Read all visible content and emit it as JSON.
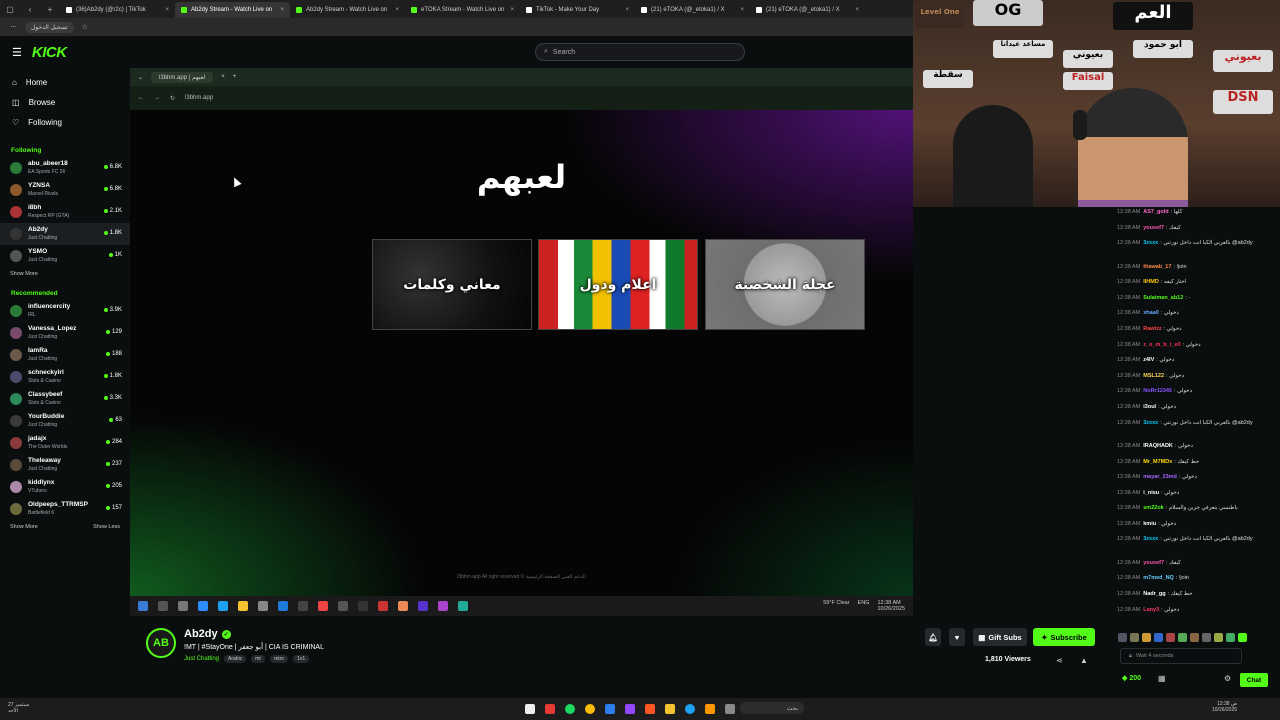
{
  "browser": {
    "tabs": [
      {
        "label": "(36)Ab2dy (@r2c) | TikTok",
        "color": "#ffffff",
        "active": false
      },
      {
        "label": "Ab2dy Stream - Watch Live on",
        "color": "#53fc18",
        "active": true
      },
      {
        "label": "Ab2dy Stream - Watch Live on",
        "color": "#53fc18",
        "active": false
      },
      {
        "label": "eTOKA Stream - Watch Live on",
        "color": "#53fc18",
        "active": false
      },
      {
        "label": "TikTok - Make Your Day",
        "color": "#ffffff",
        "active": false
      },
      {
        "label": "(21) eTOKA (@_etoka1) / X",
        "color": "#ffffff",
        "active": false
      },
      {
        "label": "(21) eTOKA (@_etoka1) / X",
        "color": "#ffffff",
        "active": false
      }
    ],
    "signin_label": "تسجيل الدخول"
  },
  "header": {
    "logo": "KICK",
    "search_placeholder": "Search"
  },
  "sidebar": {
    "nav": [
      {
        "icon": "home-icon",
        "label": "Home"
      },
      {
        "icon": "browse-icon",
        "label": "Browse"
      },
      {
        "icon": "heart-icon",
        "label": "Following"
      }
    ],
    "following_title": "Following",
    "following": [
      {
        "name": "abu_abeer18",
        "category": "EA Sports FC 26",
        "viewers": "6.8K",
        "color": "#2b7a3a"
      },
      {
        "name": "YZNSA",
        "category": "Marvel Rivals",
        "viewers": "6.8K",
        "color": "#8a5a2a"
      },
      {
        "name": "i8bh",
        "category": "Respect RP (GTA)",
        "viewers": "2.1K",
        "color": "#aa3333"
      },
      {
        "name": "Ab2dy",
        "category": "Just Chatting",
        "viewers": "1.8K",
        "color": "#333333"
      },
      {
        "name": "YSMO",
        "category": "Just Chatting",
        "viewers": "1K",
        "color": "#555555"
      }
    ],
    "show_more": "Show More",
    "recommended_title": "Recommended",
    "recommended": [
      {
        "name": "influencercity",
        "category": "IRL",
        "viewers": "3.9K",
        "color": "#2a7a3a"
      },
      {
        "name": "Vanessa_Lopez",
        "category": "Just Chatting",
        "viewers": "129",
        "color": "#7a4a6a"
      },
      {
        "name": "IamRa",
        "category": "Just Chatting",
        "viewers": "188",
        "color": "#6a5a4a"
      },
      {
        "name": "schneckyirl",
        "category": "Slots & Casino",
        "viewers": "1.8K",
        "color": "#4a4a6a"
      },
      {
        "name": "Classybeef",
        "category": "Slots & Casino",
        "viewers": "3.3K",
        "color": "#2a8a5a"
      },
      {
        "name": "YourBuddie",
        "category": "Just Chatting",
        "viewers": "63",
        "color": "#3a3a3a"
      },
      {
        "name": "jadajx",
        "category": "The Outer Worlds",
        "viewers": "284",
        "color": "#8a3a3a"
      },
      {
        "name": "Theleaway",
        "category": "Just Chatting",
        "viewers": "237",
        "color": "#5a4a3a"
      },
      {
        "name": "kiddlynx",
        "category": "VTubers",
        "viewers": "205",
        "color": "#aa88aa"
      },
      {
        "name": "Oldpeeps_TTRMSP",
        "category": "Battlefield 6",
        "viewers": "157",
        "color": "#6a6a3a"
      }
    ],
    "show_more2": "Show More",
    "show_less": "Show Less"
  },
  "stream": {
    "inner_tab": "l3bhm.app | لعبهم",
    "inner_url": "l3bhm.app",
    "game_title": "لعبهم",
    "cards": [
      {
        "label": "معاني وكلمات"
      },
      {
        "label": "اعلام ودول"
      },
      {
        "label": "عجلة الشخصنة"
      }
    ],
    "footer": "l3bhm.app All right reserved ©   الدعم الفني   الصفحة الرئيسية",
    "weather": "59°F  Clear",
    "lang": "ENG",
    "clock": "12:38 AM\n10/26/2025"
  },
  "streamer": {
    "name": "Ab2dy",
    "avatar_text": "AB",
    "title": "!MT | #StayOne | أبو جعفر | CIA IS CRIMINAL",
    "category": "Just Chatting",
    "tags": [
      "Arabic",
      "mt",
      "retro",
      "1v1"
    ],
    "viewers": "1,810 Viewers",
    "gift_label": "Gift Subs",
    "subscribe_label": "Subscribe"
  },
  "webcam": {
    "signs": [
      "العم",
      "OG",
      "Level One",
      "مساعد عيدانا",
      "بعيوني",
      "Faisal",
      "بعيوني",
      "DSN",
      "ابو حمود",
      "سقطة"
    ]
  },
  "chat": {
    "messages": [
      {
        "time": "12:38 AM",
        "user": "AS7_gold",
        "color": "#ff66cc",
        "text": "كلها",
        "two": false
      },
      {
        "time": "12:38 AM",
        "user": "yousef7",
        "color": "#ff55aa",
        "text": "كيفك",
        "two": false
      },
      {
        "time": "12:38 AM",
        "user": "3zxxx",
        "color": "#00ccff",
        "text": "بالعربي الكبا انت داخل نورتني @ab2dy",
        "two": true
      },
      {
        "time": "12:38 AM",
        "user": "thawab_17",
        "color": "#ff8844",
        "text": "!join",
        "two": false
      },
      {
        "time": "12:38 AM",
        "user": "IIHMD",
        "color": "#ffcc00",
        "text": "اختار كيفه",
        "two": false
      },
      {
        "time": "12:38 AM",
        "user": "Sulaiman_ab12",
        "color": "#53fc18",
        "text": "-",
        "two": false
      },
      {
        "time": "12:38 AM",
        "user": "xhaa0",
        "color": "#66aaff",
        "text": "دخولي",
        "two": false
      },
      {
        "time": "12:38 AM",
        "user": "Rawlzz",
        "color": "#ff4444",
        "text": "دخولي",
        "two": false
      },
      {
        "time": "12:38 AM",
        "user": "z_o_m_b_i_e0",
        "color": "#ff3355",
        "text": "دخولي",
        "two": false
      },
      {
        "time": "12:38 AM",
        "user": "z4IV",
        "color": "#ffffff",
        "text": "دخولي",
        "two": false
      },
      {
        "time": "12:38 AM",
        "user": "MSL122",
        "color": "#ffdd55",
        "text": "دخولي",
        "two": false
      },
      {
        "time": "12:38 AM",
        "user": "NoRr12345",
        "color": "#8855ff",
        "text": "دخولي",
        "two": false
      },
      {
        "time": "12:38 AM",
        "user": "i3oul",
        "color": "#ffffff",
        "text": "دخولي",
        "two": false
      },
      {
        "time": "12:38 AM",
        "user": "3zxxx",
        "color": "#00ccff",
        "text": "بالعربي الكبا انت داخل نورتني @ab2dy",
        "two": true
      },
      {
        "time": "12:38 AM",
        "user": "IRAQHADK",
        "color": "#ffffff",
        "text": "دخولي",
        "two": false
      },
      {
        "time": "12:38 AM",
        "user": "Mr_M7MDx",
        "color": "#ffdd00",
        "text": "حط كيفك",
        "two": false
      },
      {
        "time": "12:38 AM",
        "user": "mayar_23md",
        "color": "#aa66ff",
        "text": "دخولي",
        "two": false
      },
      {
        "time": "12:38 AM",
        "user": "i_nisu",
        "color": "#ffffff",
        "text": "دخولي",
        "two": false
      },
      {
        "time": "12:38 AM",
        "user": "sm22ok",
        "color": "#53fc18",
        "text": "باطنسي بتعرفي جزين والسلام",
        "two": false
      },
      {
        "time": "12:38 AM",
        "user": "kmiu",
        "color": "#ffffff",
        "text": "دخولي",
        "two": false
      },
      {
        "time": "12:38 AM",
        "user": "3zxxx",
        "color": "#00ccff",
        "text": "بالعربي الكبا انت داخل نورتني @ab2dy",
        "two": true
      },
      {
        "time": "12:38 AM",
        "user": "yousef7",
        "color": "#ff55aa",
        "text": "كيفك",
        "two": false
      },
      {
        "time": "12:38 AM",
        "user": "m7med_NQ",
        "color": "#66ccff",
        "text": "!join",
        "two": false
      },
      {
        "time": "12:38 AM",
        "user": "Nadr_gg",
        "color": "#ffffff",
        "text": "حط كيفك",
        "two": false
      },
      {
        "time": "12:38 AM",
        "user": "Lany3",
        "color": "#ff3366",
        "text": "دخولي",
        "two": false
      }
    ],
    "input_placeholder": "Wait 4 seconds",
    "points": "200",
    "chat_button": "Chat"
  },
  "taskbar": {
    "left_text": "27 سبتمبر\nالأحد",
    "search": "بحث",
    "right_text": "12:38 ص\n10/26/2025"
  }
}
